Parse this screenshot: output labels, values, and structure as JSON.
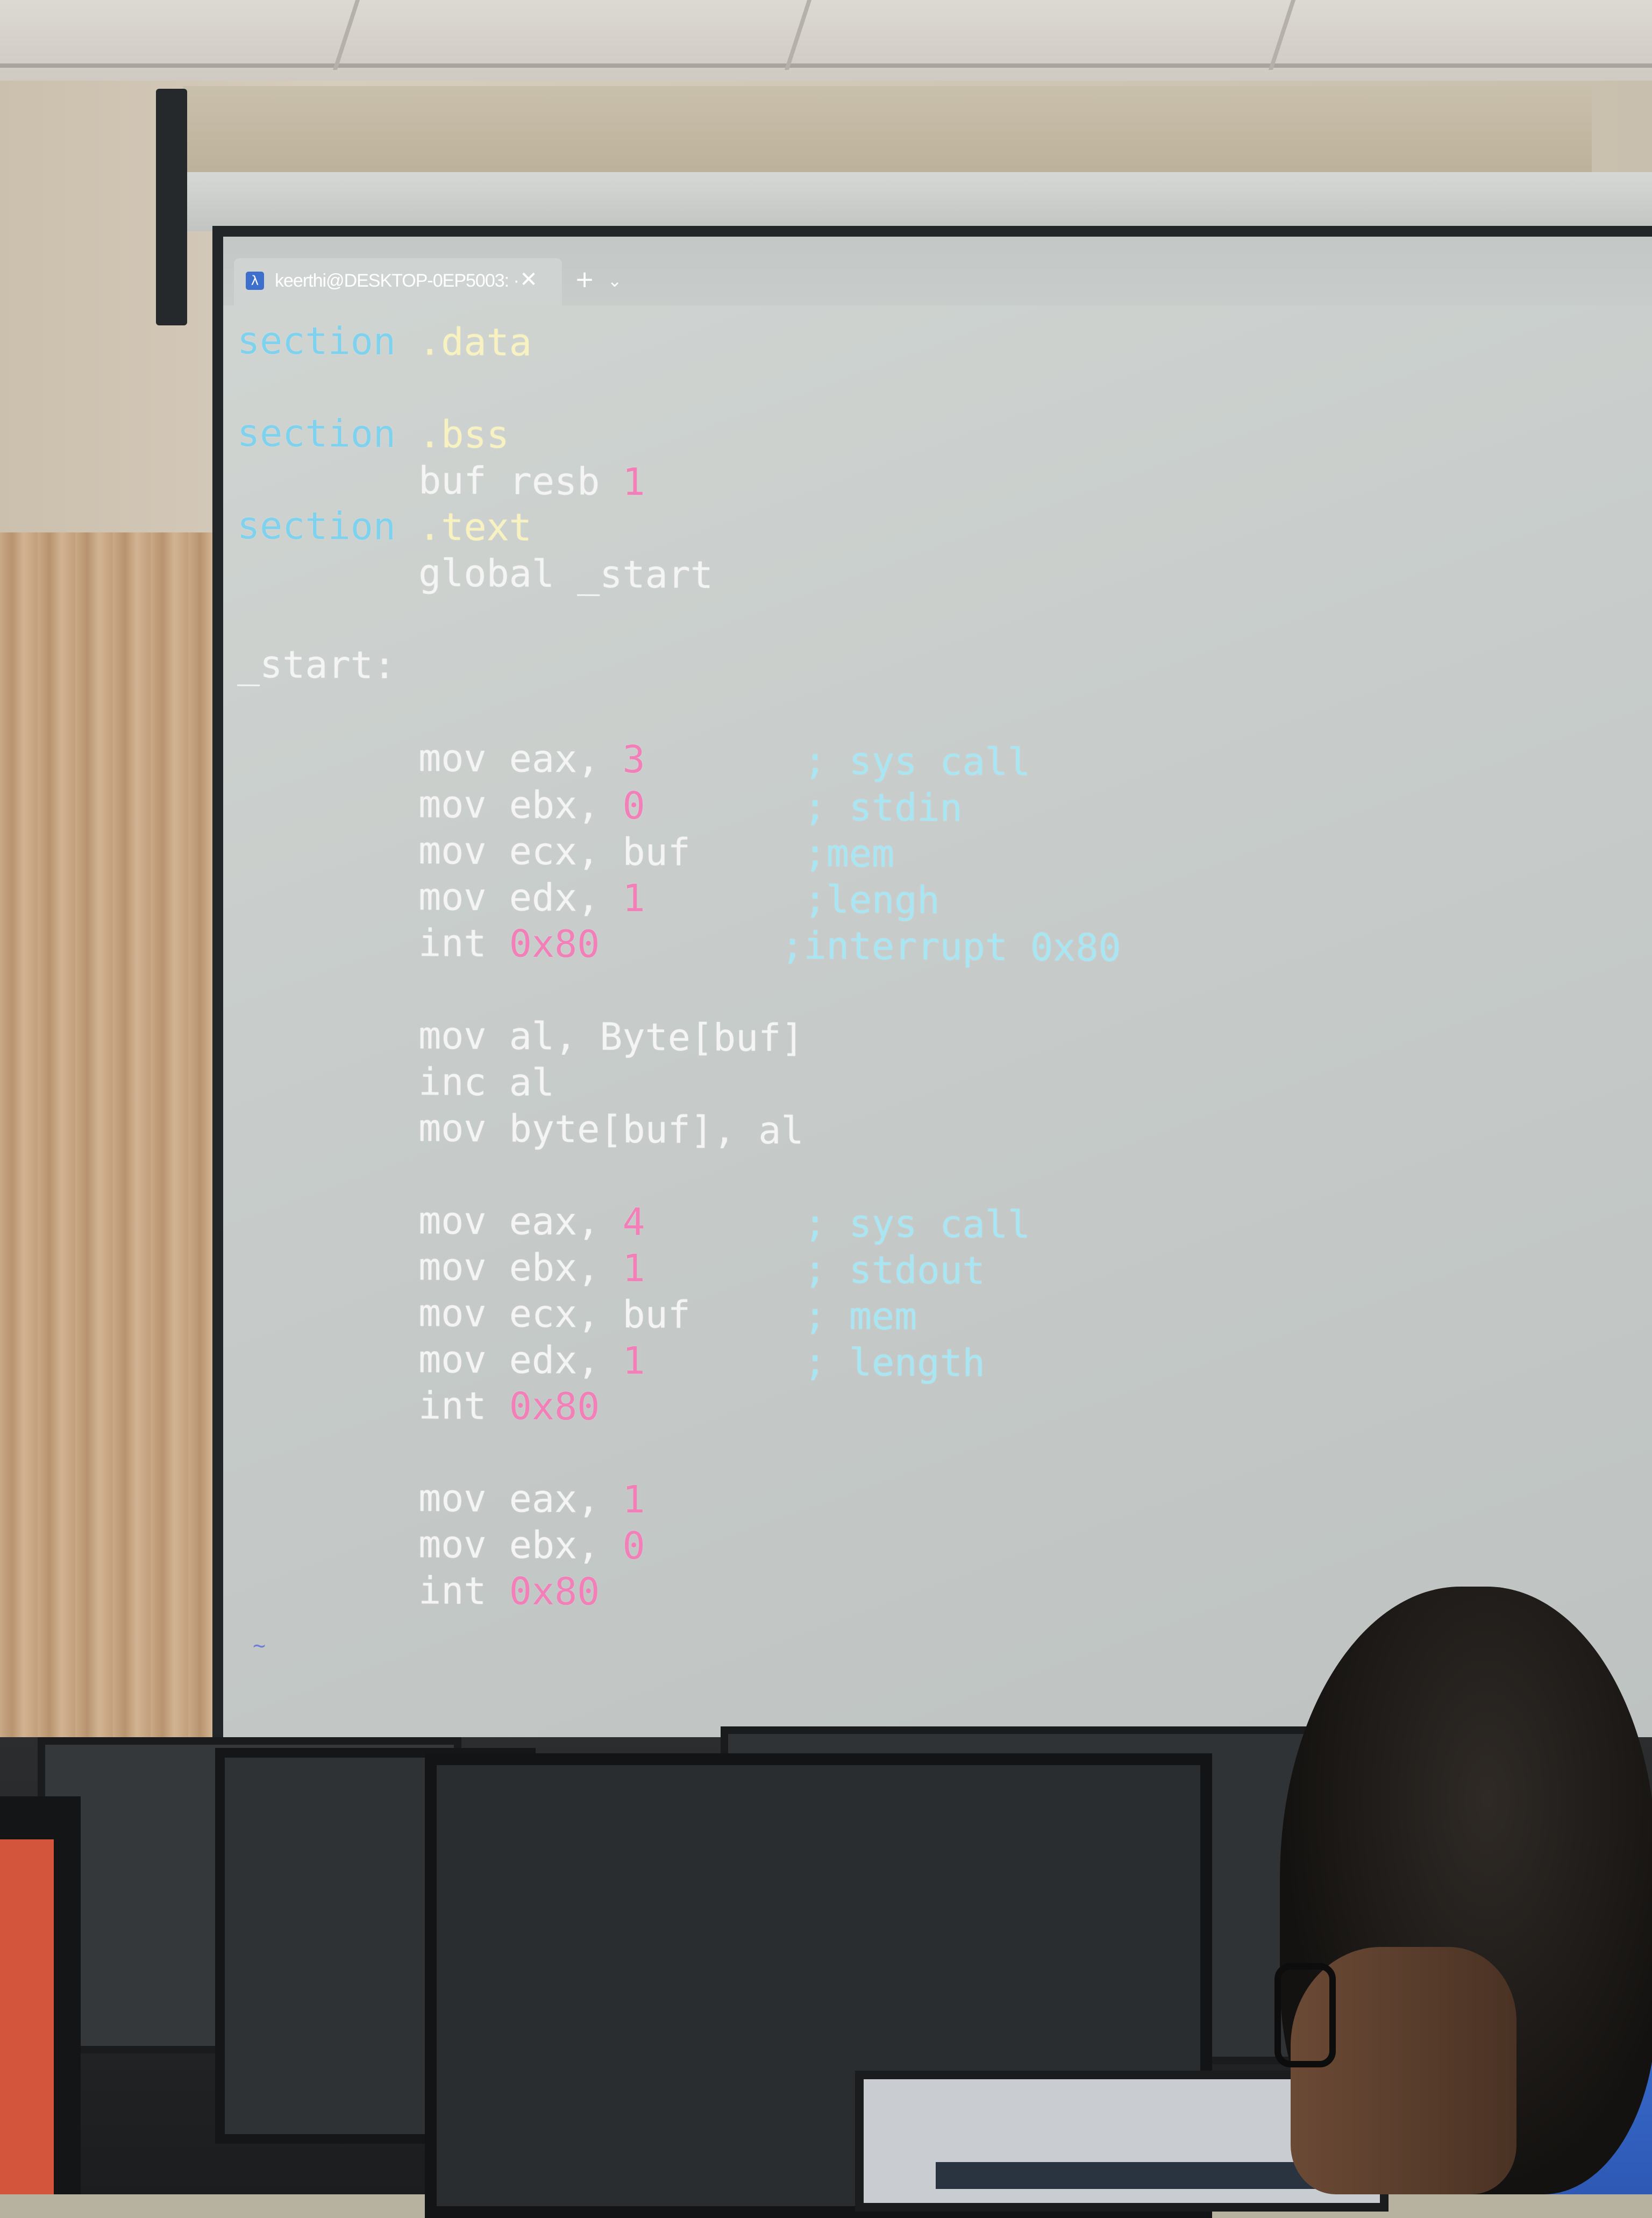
{
  "terminal": {
    "tab_title": "keerthi@DESKTOP-0EP5003: ·",
    "tab_icon": "powershell-icon",
    "close_symbol": "✕",
    "add_symbol": "+",
    "dropdown_symbol": "⌄",
    "empty_line_marker": "~",
    "lines": [
      [
        {
          "t": "section",
          "c": "kw"
        },
        {
          "t": " .data",
          "c": "dir"
        }
      ],
      [],
      [
        {
          "t": "section",
          "c": "kw"
        },
        {
          "t": " .bss",
          "c": "dir"
        }
      ],
      [
        {
          "t": "        buf resb ",
          "c": "id"
        },
        {
          "t": "1",
          "c": "num"
        }
      ],
      [
        {
          "t": "section",
          "c": "kw"
        },
        {
          "t": " .text",
          "c": "dir"
        }
      ],
      [
        {
          "t": "        global _start",
          "c": "id"
        }
      ],
      [],
      [
        {
          "t": "_start:",
          "c": "id"
        }
      ],
      [],
      [
        {
          "t": "        mov eax, ",
          "c": "id"
        },
        {
          "t": "3",
          "c": "num"
        },
        {
          "t": "       ; sys call",
          "c": "cmt"
        }
      ],
      [
        {
          "t": "        mov ebx, ",
          "c": "id"
        },
        {
          "t": "0",
          "c": "num"
        },
        {
          "t": "       ; stdin",
          "c": "cmt"
        }
      ],
      [
        {
          "t": "        mov ecx, buf",
          "c": "id"
        },
        {
          "t": "     ;mem",
          "c": "cmt"
        }
      ],
      [
        {
          "t": "        mov edx, ",
          "c": "id"
        },
        {
          "t": "1",
          "c": "num"
        },
        {
          "t": "       ;lengh",
          "c": "cmt"
        }
      ],
      [
        {
          "t": "        int ",
          "c": "id"
        },
        {
          "t": "0x80",
          "c": "num"
        },
        {
          "t": "        ;interrupt 0x80",
          "c": "cmt"
        }
      ],
      [],
      [
        {
          "t": "        mov al, Byte[buf]",
          "c": "id"
        }
      ],
      [
        {
          "t": "        inc al",
          "c": "id"
        }
      ],
      [
        {
          "t": "        mov byte[buf], al",
          "c": "id"
        }
      ],
      [],
      [
        {
          "t": "        mov eax, ",
          "c": "id"
        },
        {
          "t": "4",
          "c": "num"
        },
        {
          "t": "       ; sys call",
          "c": "cmt"
        }
      ],
      [
        {
          "t": "        mov ebx, ",
          "c": "id"
        },
        {
          "t": "1",
          "c": "num"
        },
        {
          "t": "       ; stdout",
          "c": "cmt"
        }
      ],
      [
        {
          "t": "        mov ecx, buf",
          "c": "id"
        },
        {
          "t": "     ; mem",
          "c": "cmt"
        }
      ],
      [
        {
          "t": "        mov edx, ",
          "c": "id"
        },
        {
          "t": "1",
          "c": "num"
        },
        {
          "t": "       ; length",
          "c": "cmt"
        }
      ],
      [
        {
          "t": "        int ",
          "c": "id"
        },
        {
          "t": "0x80",
          "c": "num"
        }
      ],
      [],
      [
        {
          "t": "        mov eax, ",
          "c": "id"
        },
        {
          "t": "1",
          "c": "num"
        }
      ],
      [
        {
          "t": "        mov ebx, ",
          "c": "id"
        },
        {
          "t": "0",
          "c": "num"
        }
      ],
      [
        {
          "t": "        int ",
          "c": "id"
        },
        {
          "t": "0x80",
          "c": "num"
        }
      ]
    ]
  },
  "colors": {
    "keyword": "#7fd2ee",
    "directive": "#f8f2c0",
    "number": "#f37fb8",
    "comment": "#a8e6f4",
    "screen_background": "#c9cecc"
  }
}
